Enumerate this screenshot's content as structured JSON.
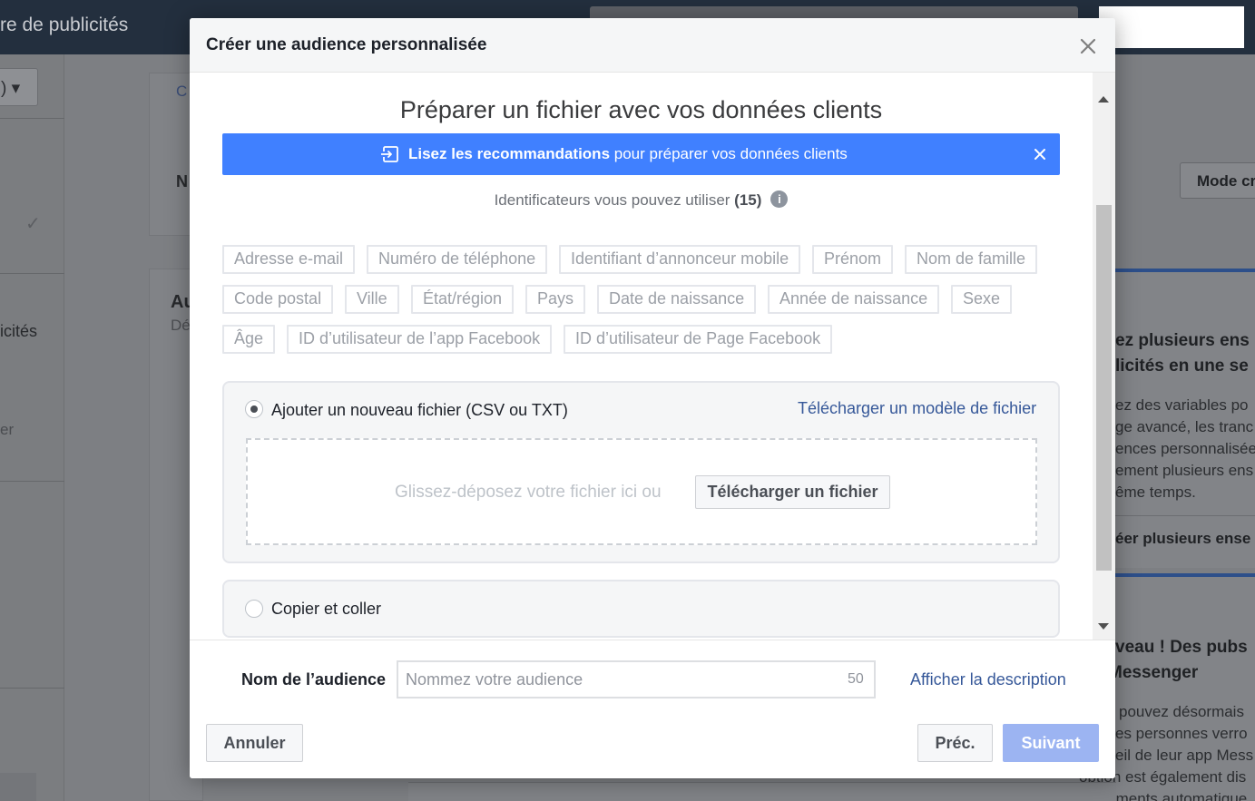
{
  "background": {
    "topbar_title": "re de publicités",
    "select_label": ") ▾",
    "check_icon": "check-icon",
    "side_text_1": "icités",
    "side_text_2": "er",
    "card_link": "C",
    "card_label_n": "N",
    "card_heading": "Au",
    "card_sub": "Dé",
    "mode_button": "Mode cr",
    "promo1_heading_line1": "ez plusieurs ens",
    "promo1_heading_line2": "licités en une se",
    "promo1_body": [
      "ez des variables po",
      "ge avancé, les tranc",
      "ences personnalisée",
      "ement plusieurs ens",
      "ême temps."
    ],
    "promo1_link": "éer plusieurs ense",
    "promo2_heading_line1": "veau ! Des pubs",
    "promo2_heading_line2": "Messenger",
    "promo2_body": [
      "pouvez désormais",
      "es personnes verro",
      "eil de leur app Mess",
      "option est également dis",
      "placements automatique"
    ]
  },
  "modal": {
    "title": "Créer une audience personnalisée",
    "close_icon": "close-icon",
    "section_title": "Préparer un fichier avec vos données clients",
    "banner": {
      "bold": "Lisez les recommandations",
      "rest": " pour préparer vos données clients",
      "bg_color": "#4080ff"
    },
    "identifiers": {
      "label": "Identificateurs vous pouvez utiliser",
      "count": "(15)",
      "info_icon": "info-icon"
    },
    "tags": [
      "Adresse e-mail",
      "Numéro de téléphone",
      "Identifiant d’annonceur mobile",
      "Prénom",
      "Nom de famille",
      "Code postal",
      "Ville",
      "État/région",
      "Pays",
      "Date de naissance",
      "Année de naissance",
      "Sexe",
      "Âge",
      "ID d’utilisateur de l’app Facebook",
      "ID d’utilisateur de Page Facebook"
    ],
    "option_file": {
      "label": "Ajouter un nouveau fichier (CSV ou TXT)",
      "selected": true,
      "template_link": "Télécharger un modèle de fichier",
      "drop_hint": "Glissez-déposez votre fichier ici ou",
      "upload_button": "Télécharger un fichier"
    },
    "option_paste": {
      "label": "Copier et coller",
      "selected": false
    },
    "footer": {
      "audience_label": "Nom de l’audience",
      "audience_placeholder": "Nommez votre audience",
      "char_limit": "50",
      "description_link": "Afficher la description",
      "cancel": "Annuler",
      "prev": "Préc.",
      "next": "Suivant"
    }
  }
}
